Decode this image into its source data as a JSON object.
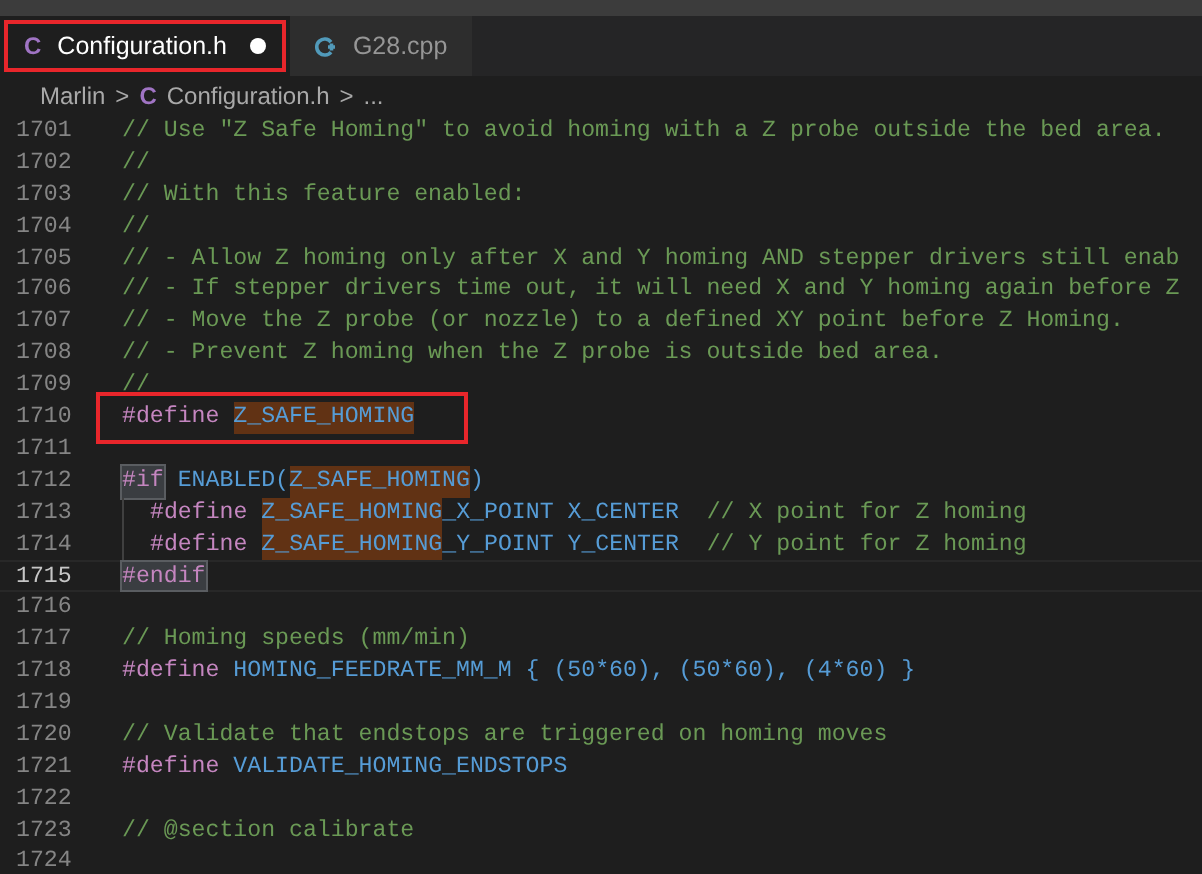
{
  "tabs": [
    {
      "label": "Configuration.h",
      "icon_text": "C",
      "kind": "c",
      "selected": true,
      "modified": true,
      "boxed": true
    },
    {
      "label": "G28.cpp",
      "kind": "cpp",
      "selected": false,
      "modified": false,
      "boxed": false
    }
  ],
  "breadcrumb": {
    "folder": "Marlin",
    "separator_1": ">",
    "icon_text": "C",
    "file": "Configuration.h",
    "separator_2": ">",
    "more": "..."
  },
  "lines": [
    {
      "number": "1701",
      "current": false,
      "boxed": false,
      "indent": false,
      "tokens": [
        {
          "kind": "comment",
          "text": "// Use \"Z Safe Homing\" to avoid homing with a Z probe outside the bed area."
        }
      ]
    },
    {
      "number": "1702",
      "current": false,
      "boxed": false,
      "indent": false,
      "tokens": [
        {
          "kind": "comment",
          "text": "//"
        }
      ]
    },
    {
      "number": "1703",
      "current": false,
      "boxed": false,
      "indent": false,
      "tokens": [
        {
          "kind": "comment",
          "text": "// With this feature enabled:"
        }
      ]
    },
    {
      "number": "1704",
      "current": false,
      "boxed": false,
      "indent": false,
      "tokens": [
        {
          "kind": "comment",
          "text": "//"
        }
      ]
    },
    {
      "number": "1705",
      "current": false,
      "boxed": false,
      "indent": false,
      "tokens": [
        {
          "kind": "comment",
          "text": "// - Allow Z homing only after X and Y homing AND stepper drivers still enab"
        }
      ]
    },
    {
      "number": "1706",
      "current": false,
      "boxed": false,
      "indent": false,
      "tokens": [
        {
          "kind": "comment",
          "text": "// - If stepper drivers time out, it will need X and Y homing again before Z"
        }
      ]
    },
    {
      "number": "1707",
      "current": false,
      "boxed": false,
      "indent": false,
      "tokens": [
        {
          "kind": "comment",
          "text": "// - Move the Z probe (or nozzle) to a defined XY point before Z Homing."
        }
      ]
    },
    {
      "number": "1708",
      "current": false,
      "boxed": false,
      "indent": false,
      "tokens": [
        {
          "kind": "comment",
          "text": "// - Prevent Z homing when the Z probe is outside bed area."
        }
      ]
    },
    {
      "number": "1709",
      "current": false,
      "boxed": false,
      "indent": false,
      "tokens": [
        {
          "kind": "comment",
          "text": "//"
        }
      ]
    },
    {
      "number": "1710",
      "current": false,
      "boxed": true,
      "indent": false,
      "tokens": [
        {
          "kind": "directive",
          "text": "#define "
        },
        {
          "kind": "highlight",
          "text": "Z_SAFE_HOMING"
        }
      ]
    },
    {
      "number": "1711",
      "current": false,
      "boxed": false,
      "indent": false
    },
    {
      "number": "1712",
      "current": false,
      "boxed": false,
      "indent": false,
      "tokens": [
        {
          "kind": "directive_match",
          "text": "#if"
        },
        {
          "kind": "macro",
          "text": " ENABLED("
        },
        {
          "kind": "highlight",
          "text": "Z_SAFE_HOMING"
        },
        {
          "kind": "macro",
          "text": ")"
        }
      ]
    },
    {
      "number": "1713",
      "current": false,
      "boxed": false,
      "indent": true,
      "tokens": [
        {
          "kind": "directive",
          "text": "#define "
        },
        {
          "kind": "highlight",
          "text": "Z_SAFE_HOMING"
        },
        {
          "kind": "macro",
          "text": "_X_POINT X_CENTER  "
        },
        {
          "kind": "comment",
          "text": "// X point for Z homing"
        }
      ]
    },
    {
      "number": "1714",
      "current": false,
      "boxed": false,
      "indent": true,
      "tokens": [
        {
          "kind": "directive",
          "text": "#define "
        },
        {
          "kind": "highlight",
          "text": "Z_SAFE_HOMING"
        },
        {
          "kind": "macro",
          "text": "_Y_POINT Y_CENTER  "
        },
        {
          "kind": "comment",
          "text": "// Y point for Z homing"
        }
      ]
    },
    {
      "number": "1715",
      "current": true,
      "boxed": false,
      "indent": false,
      "tokens": [
        {
          "kind": "directive_match",
          "text": "#endif"
        }
      ]
    },
    {
      "number": "1716",
      "current": false,
      "boxed": false,
      "indent": false
    },
    {
      "number": "1717",
      "current": false,
      "boxed": false,
      "indent": false,
      "tokens": [
        {
          "kind": "comment",
          "text": "// Homing speeds (mm/min)"
        }
      ]
    },
    {
      "number": "1718",
      "current": false,
      "boxed": false,
      "indent": false,
      "tokens": [
        {
          "kind": "directive",
          "text": "#define "
        },
        {
          "kind": "macro",
          "text": "HOMING_FEEDRATE_MM_M { (50*60), (50*60), (4*60) }"
        }
      ]
    },
    {
      "number": "1719",
      "current": false,
      "boxed": false,
      "indent": false
    },
    {
      "number": "1720",
      "current": false,
      "boxed": false,
      "indent": false,
      "tokens": [
        {
          "kind": "comment",
          "text": "// Validate that endstops are triggered on homing moves"
        }
      ]
    },
    {
      "number": "1721",
      "current": false,
      "boxed": false,
      "indent": false,
      "tokens": [
        {
          "kind": "directive",
          "text": "#define "
        },
        {
          "kind": "macro",
          "text": "VALIDATE_HOMING_ENDSTOPS"
        }
      ]
    },
    {
      "number": "1722",
      "current": false,
      "boxed": false,
      "indent": false
    },
    {
      "number": "1723",
      "current": false,
      "boxed": false,
      "indent": false,
      "tokens": [
        {
          "kind": "comment",
          "text": "// @section calibrate"
        }
      ]
    },
    {
      "number": "1724",
      "current": false,
      "boxed": false,
      "indent": false
    }
  ]
}
